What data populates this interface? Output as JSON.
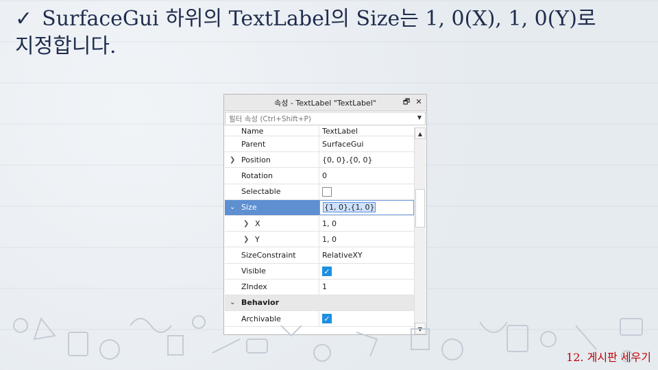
{
  "slide": {
    "title_line1": "SurfaceGui 하위의 TextLabel의 Size는 1, 0(X), 1, 0(Y)로",
    "title_line2": "지정합니다.",
    "footer": "12. 게시판 세우기"
  },
  "properties": {
    "window_title": "속성 - TextLabel \"TextLabel\"",
    "filter_placeholder": "필터 속성 (Ctrl+Shift+P)",
    "rows": [
      {
        "name": "Name",
        "value": "TextLabel"
      },
      {
        "name": "Parent",
        "value": "SurfaceGui"
      },
      {
        "name": "Position",
        "value": "{0, 0},{0, 0}"
      },
      {
        "name": "Rotation",
        "value": "0"
      },
      {
        "name": "Selectable",
        "value": ""
      },
      {
        "name": "Size",
        "value": "{1, 0},{1, 0}"
      },
      {
        "name": "X",
        "value": "1, 0"
      },
      {
        "name": "Y",
        "value": "1, 0"
      },
      {
        "name": "SizeConstraint",
        "value": "RelativeXY"
      },
      {
        "name": "Visible",
        "value": ""
      },
      {
        "name": "ZIndex",
        "value": "1"
      },
      {
        "name": "Behavior",
        "value": ""
      },
      {
        "name": "Archivable",
        "value": ""
      }
    ],
    "icons": {
      "restore": "restore-window-icon",
      "close": "close-icon",
      "dropdown": "chevron-down-icon",
      "collapsed": "chevron-right-icon",
      "expanded": "chevron-down-icon",
      "check": "checkmark-icon"
    }
  }
}
